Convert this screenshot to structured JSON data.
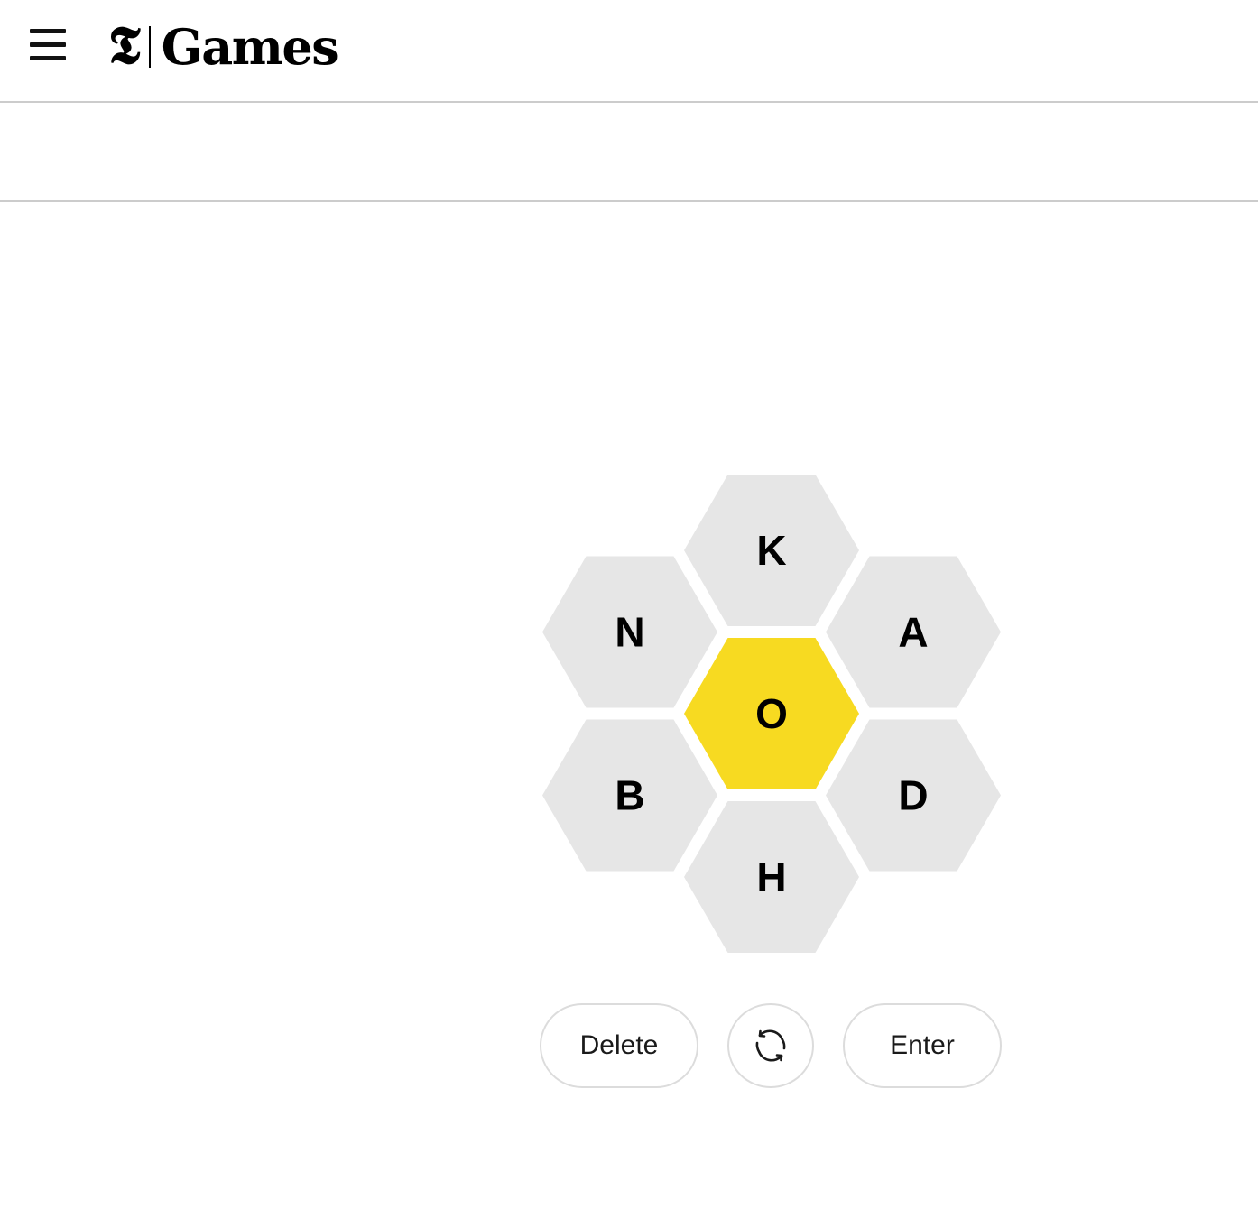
{
  "header": {
    "menu_icon": "hamburger-menu-icon",
    "logo_mark": "𝕿",
    "title": "Games"
  },
  "game": {
    "center_letter": "O",
    "outer_letters": [
      "K",
      "A",
      "D",
      "H",
      "B",
      "N"
    ],
    "colors": {
      "center": "#f7da21",
      "outer": "#e6e6e6"
    }
  },
  "controls": {
    "delete_label": "Delete",
    "shuffle_icon": "shuffle-icon",
    "enter_label": "Enter"
  }
}
